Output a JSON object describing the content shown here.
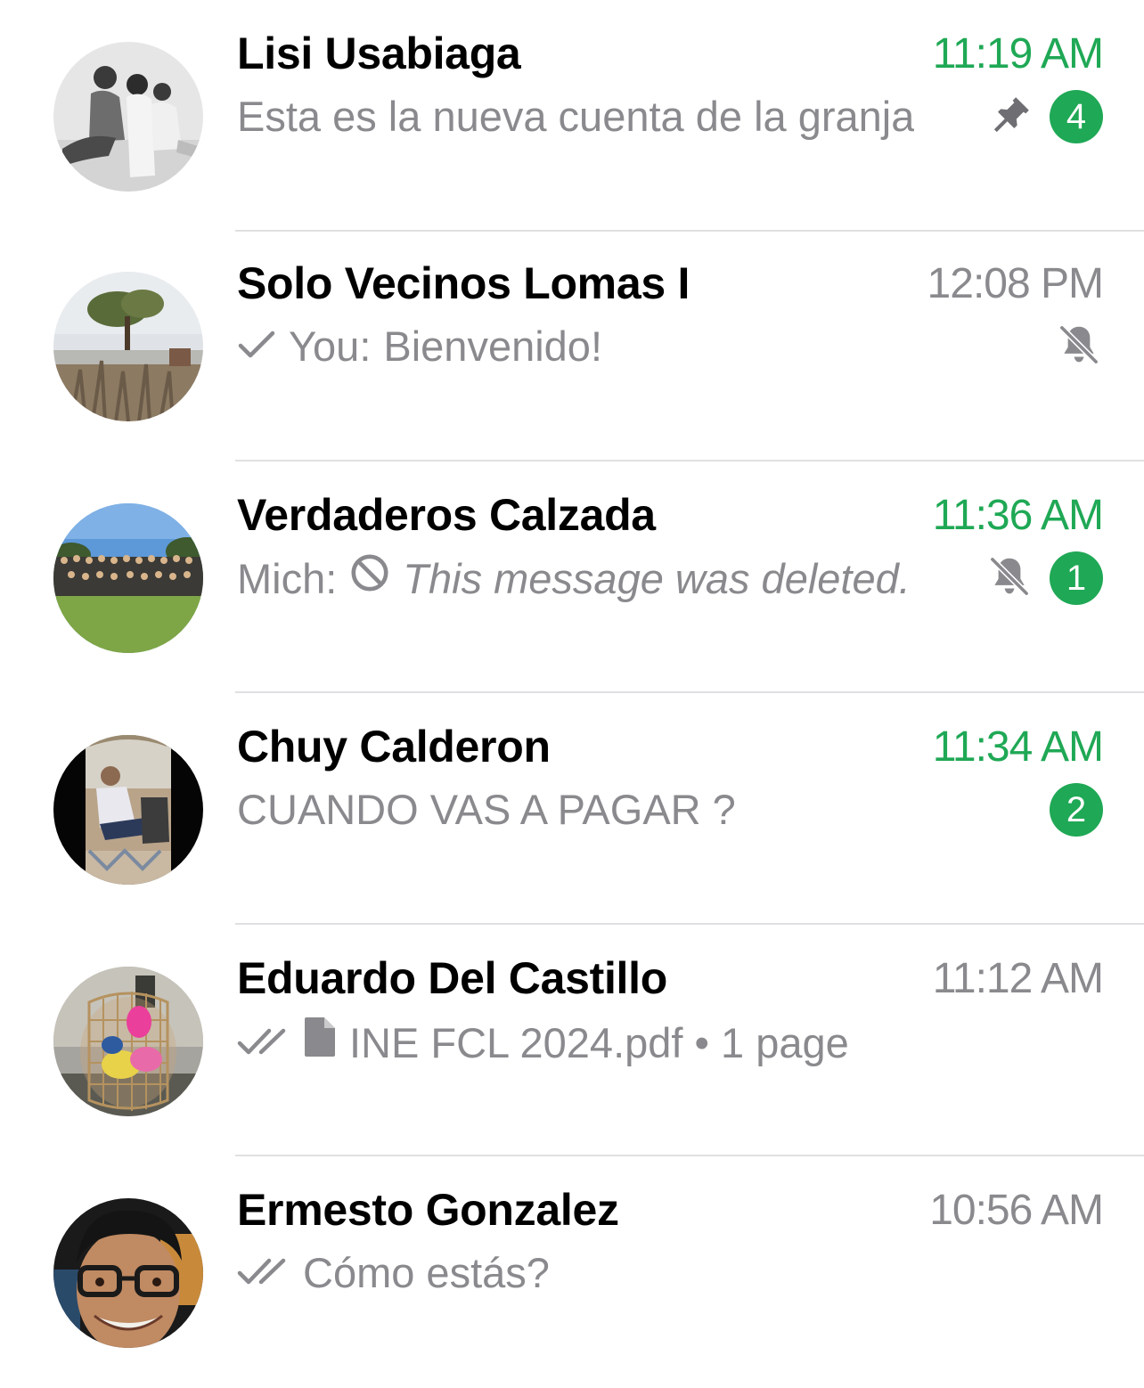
{
  "colors": {
    "accent": "#1fa855",
    "secondary_text": "#8a8a8e",
    "primary_text": "#000000",
    "divider": "#e0e0e2"
  },
  "chats": [
    {
      "name": "Lisi Usabiaga",
      "time": "11:19 AM",
      "time_unread": true,
      "preview": "Esta es la nueva cuenta de la granja",
      "pinned": true,
      "muted": false,
      "unread_count": "4",
      "avatar": "family-photo-bw"
    },
    {
      "name": "Solo Vecinos Lomas I",
      "time": "12:08 PM",
      "time_unread": false,
      "check": "single-check-icon",
      "sender": "You:",
      "preview": "Bienvenido!",
      "muted": true,
      "avatar": "tree-landscape-photo"
    },
    {
      "name": "Verdaderos Calzada",
      "time": "11:36 AM",
      "time_unread": true,
      "sender": "Mich:",
      "preview": "This message was deleted.",
      "deleted": true,
      "muted": true,
      "unread_count": "1",
      "avatar": "group-outdoor-photo"
    },
    {
      "name": "Chuy Calderon",
      "time": "11:34 AM",
      "time_unread": true,
      "preview": "CUANDO VAS A PAGAR ?",
      "unread_count": "2",
      "avatar": "man-seated-photo"
    },
    {
      "name": "Eduardo Del Castillo",
      "time": "11:12 AM",
      "time_unread": false,
      "check": "double-check-icon",
      "attachment": "document-icon",
      "preview": "INE FCL 2024.pdf • 1 page",
      "avatar": "basket-photo"
    },
    {
      "name": "Ermesto Gonzalez",
      "time": "10:56 AM",
      "time_unread": false,
      "check": "double-check-icon",
      "preview": "Cómo estás?",
      "avatar": "man-glasses-photo"
    }
  ]
}
